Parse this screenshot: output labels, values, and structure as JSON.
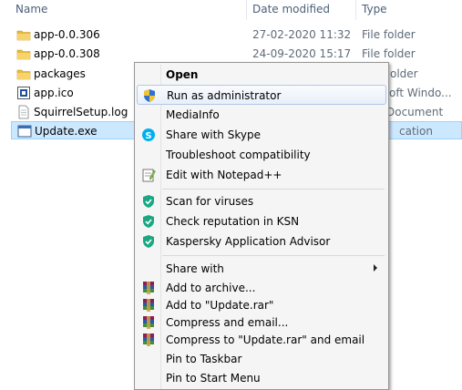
{
  "header": {
    "name_label": "Name",
    "date_label": "Date modified",
    "type_label": "Type"
  },
  "files": [
    {
      "name": "app-0.0.306",
      "date": "27-02-2020 11:32",
      "type": "File folder",
      "icon": "folder-icon"
    },
    {
      "name": "app-0.0.308",
      "date": "24-09-2020 15:17",
      "type": "File folder",
      "icon": "folder-icon"
    },
    {
      "name": "packages",
      "date": "",
      "type": "older",
      "icon": "folder-icon"
    },
    {
      "name": "app.ico",
      "date": "",
      "type": "oft Windo...",
      "icon": "ico-file-icon"
    },
    {
      "name": "SquirrelSetup.log",
      "date": "",
      "type": "Document",
      "icon": "text-file-icon"
    },
    {
      "name": "Update.exe",
      "date": "",
      "type": "cation",
      "icon": "exe-file-icon",
      "selected": true
    }
  ],
  "menu": {
    "items": [
      {
        "label": "Open",
        "icon": "",
        "bold": true
      },
      {
        "label": "Run as administrator",
        "icon": "uac-shield-icon",
        "highlight": true
      },
      {
        "label": "MediaInfo",
        "icon": ""
      },
      {
        "label": "Share with Skype",
        "icon": "skype-icon"
      },
      {
        "label": "Troubleshoot compatibility",
        "icon": ""
      },
      {
        "label": "Edit with Notepad++",
        "icon": "notepad-plus-icon"
      },
      {
        "label": "Scan for viruses",
        "icon": "kaspersky-icon"
      },
      {
        "label": "Check reputation in KSN",
        "icon": "kaspersky-icon"
      },
      {
        "label": "Kaspersky Application Advisor",
        "icon": "kaspersky-icon"
      },
      {
        "label": "Share with",
        "icon": "",
        "submenu": true
      },
      {
        "label": "Add to archive...",
        "icon": "winrar-icon"
      },
      {
        "label": "Add to \"Update.rar\"",
        "icon": "winrar-icon"
      },
      {
        "label": "Compress and email...",
        "icon": "winrar-icon"
      },
      {
        "label": "Compress to \"Update.rar\" and email",
        "icon": "winrar-icon"
      },
      {
        "label": "Pin to Taskbar",
        "icon": ""
      },
      {
        "label": "Pin to Start Menu",
        "icon": ""
      }
    ]
  },
  "colors": {
    "selection_bg": "#cce8ff",
    "menu_bg": "#f5f5f5",
    "kaspersky_green": "#1aa782"
  }
}
